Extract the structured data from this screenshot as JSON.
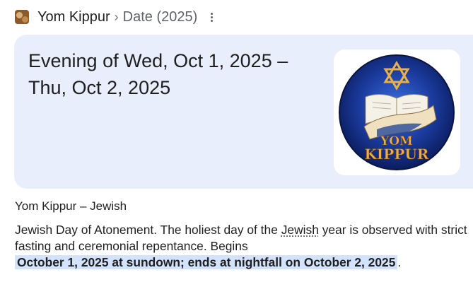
{
  "breadcrumb": {
    "title": "Yom Kippur",
    "separator": "›",
    "subtitle": "Date (2025)"
  },
  "answer": {
    "line1": "Evening of Wed, Oct 1, 2025 –",
    "line2": "Thu, Oct 2, 2025"
  },
  "image": {
    "logo_line1": "YOM",
    "logo_line2": "KIPPUR"
  },
  "source_label": "Yom Kippur – Jewish",
  "description": {
    "part1": "Jewish Day of Atonement. The holiest day of the ",
    "underlined": "Jewish",
    "part2": " year is observed with strict fasting and ceremonial repentance. Begins",
    "highlight": "October 1, 2025 at sundown; ends at nightfall on October 2, 2025",
    "end": "."
  },
  "colors": {
    "card_bg": "#e9eefc",
    "highlight_bg": "#d3e3fd",
    "logo_blue": "#1a3a9c",
    "logo_gold": "#e8b04a"
  },
  "icons": [
    "thumbnail-image-icon",
    "more-vert-icon",
    "star-of-david-icon",
    "shofar-icon",
    "book-icon"
  ]
}
